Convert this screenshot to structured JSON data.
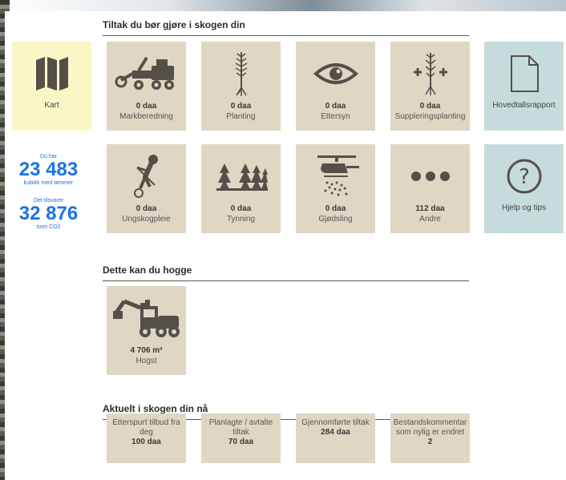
{
  "sections": {
    "tiltak_title": "Tiltak du bør gjøre i skogen din",
    "hogge_title": "Dette kan du hogge",
    "aktuelt_title": "Aktuelt i skogen din nå"
  },
  "sidebar": {
    "kart_label": "Kart",
    "du_har": "Du har",
    "volume": "23 483",
    "volume_unit": "kubikk med tømmer",
    "tilsvarer": "Det tilsvarer",
    "co2": "32 876",
    "co2_unit": "tonn CO2"
  },
  "tiltak_row1": [
    {
      "value": "0 daa",
      "label": "Markberedning",
      "icon": "tractor-icon"
    },
    {
      "value": "0 daa",
      "label": "Planting",
      "icon": "seedling-icon"
    },
    {
      "value": "0 daa",
      "label": "Ettersyn",
      "icon": "eye-icon"
    },
    {
      "value": "0 daa",
      "label": "Suppleringsplanting",
      "icon": "plus-seedling-icon"
    }
  ],
  "tiltak_row2": [
    {
      "value": "0 daa",
      "label": "Ungskogpleie",
      "icon": "brush-saw-icon"
    },
    {
      "value": "0 daa",
      "label": "Tynning",
      "icon": "trees-icon"
    },
    {
      "value": "0 daa",
      "label": "Gjødsling",
      "icon": "helicopter-icon"
    },
    {
      "value": "112 daa",
      "label": "Andre",
      "icon": "more-icon"
    }
  ],
  "right_tiles": {
    "report_label": "Hovedtallsrapport",
    "help_label": "Hjelp og tips"
  },
  "hogst": {
    "value": "4 706 m³",
    "label": "Hogst"
  },
  "aktuelt": [
    {
      "text": "Etterspurt tilbud fra deg",
      "value": "100 daa"
    },
    {
      "text": "Planlagte / avtalte tiltak",
      "value": "70 daa"
    },
    {
      "text": "Gjennomførte tiltak",
      "value": "284 daa"
    },
    {
      "text": "Bestandskommentar som nylig er endret",
      "value": "2"
    }
  ],
  "colors": {
    "tile": "#e0d6c4",
    "kart_tile": "#fbf6c6",
    "info_tile": "#c6dcdc",
    "stat_blue": "#1a73e8",
    "icon": "#545048"
  }
}
